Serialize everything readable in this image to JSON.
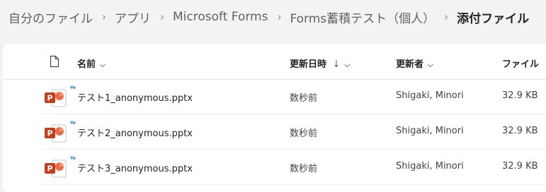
{
  "breadcrumb": {
    "items": [
      "自分のファイル",
      "アプリ",
      "Microsoft Forms",
      "Forms蓄積テスト（個人）"
    ],
    "current": "添付ファイル"
  },
  "table": {
    "headers": {
      "name": "名前",
      "modified": "更新日時",
      "sort_indicator": "↓",
      "modified_by": "更新者",
      "size": "ファイル"
    },
    "rows": [
      {
        "name": "テスト1_anonymous.pptx",
        "modified": "数秒前",
        "modified_by": "Shigaki, Minori",
        "size": "32.9 KB"
      },
      {
        "name": "テスト2_anonymous.pptx",
        "modified": "数秒前",
        "modified_by": "Shigaki, Minori",
        "size": "32.9 KB"
      },
      {
        "name": "テスト3_anonymous.pptx",
        "modified": "数秒前",
        "modified_by": "Shigaki, Minori",
        "size": "32.9 KB"
      }
    ]
  },
  "icons": {
    "file_type_header": "document-icon",
    "row_file": "powerpoint-icon",
    "new_marker": "new-item-sparkle-icon"
  },
  "colors": {
    "powerpoint_brand": "#c43e1c",
    "new_marker": "#0f6cbd"
  }
}
